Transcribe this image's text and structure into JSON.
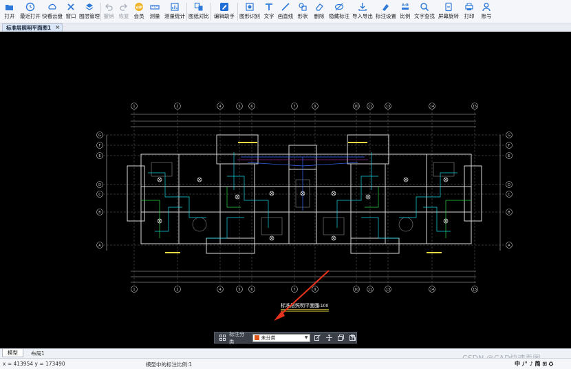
{
  "toolbar": {
    "items": [
      {
        "label": "打开",
        "icon": "folder-open-icon",
        "enabled": true
      },
      {
        "label": "最近打开",
        "icon": "clock-icon",
        "enabled": true
      },
      {
        "label": "快看云盘",
        "icon": "cloud-icon",
        "enabled": true
      },
      {
        "label": "窗口",
        "icon": "window-icon",
        "enabled": true
      },
      {
        "label": "图层管理",
        "icon": "layers-icon",
        "enabled": true
      },
      {
        "label": "撤销",
        "icon": "undo-icon",
        "enabled": false
      },
      {
        "label": "恢复",
        "icon": "redo-icon",
        "enabled": false
      },
      {
        "label": "会员",
        "icon": "vip-badge-icon",
        "enabled": true
      },
      {
        "label": "测量",
        "icon": "measure-icon",
        "enabled": true
      },
      {
        "label": "测量统计",
        "icon": "measure-stats-icon",
        "enabled": true
      },
      {
        "label": "图纸对比",
        "icon": "compare-icon",
        "enabled": true
      },
      {
        "label": "编辑助手",
        "icon": "edit-assistant-icon",
        "enabled": true
      },
      {
        "label": "图形识别",
        "icon": "shape-recognize-icon",
        "enabled": true
      },
      {
        "label": "文字",
        "icon": "text-icon",
        "enabled": true
      },
      {
        "label": "画直线",
        "icon": "line-icon",
        "enabled": true
      },
      {
        "label": "形状",
        "icon": "shape-icon",
        "enabled": true
      },
      {
        "label": "删除",
        "icon": "eraser-icon",
        "enabled": true
      },
      {
        "label": "隐藏标注",
        "icon": "hide-annotation-icon",
        "enabled": true
      },
      {
        "label": "导入导出",
        "icon": "import-export-icon",
        "enabled": true
      },
      {
        "label": "标注设置",
        "icon": "annotation-settings-icon",
        "enabled": true
      },
      {
        "label": "比例",
        "icon": "scale-icon",
        "enabled": true
      },
      {
        "label": "文字查找",
        "icon": "text-search-icon",
        "enabled": true
      },
      {
        "label": "屏幕旋转",
        "icon": "rotate-screen-icon",
        "enabled": true
      },
      {
        "label": "打印",
        "icon": "printer-icon",
        "enabled": true
      },
      {
        "label": "账号",
        "icon": "user-icon",
        "enabled": true
      }
    ]
  },
  "document_tab": {
    "title": "标准层照明平面图1",
    "close": "×"
  },
  "drawing": {
    "title": "标准层照明平面图",
    "scale_label": "1:100",
    "grid_top": [
      "1",
      "2",
      "4",
      "5",
      "6",
      "7",
      "9",
      "10",
      "11",
      "13",
      "14",
      "15"
    ],
    "grid_side": [
      "G",
      "F",
      "E",
      "D",
      "C",
      "B",
      "A"
    ]
  },
  "annotation_bar": {
    "label": "标注分类",
    "selected": "未分类",
    "swatch_color": "#e0571c"
  },
  "bottom_tabs": {
    "model": "模型",
    "layout1": "布局1"
  },
  "status": {
    "coords": "x = 413954  y = 173490",
    "scale_text": "模型中的标注比例:1"
  },
  "watermark": "CSDN @CAD快速看图",
  "ime": "中 ﾉ° ♪ 简 ⊞ ⛭"
}
